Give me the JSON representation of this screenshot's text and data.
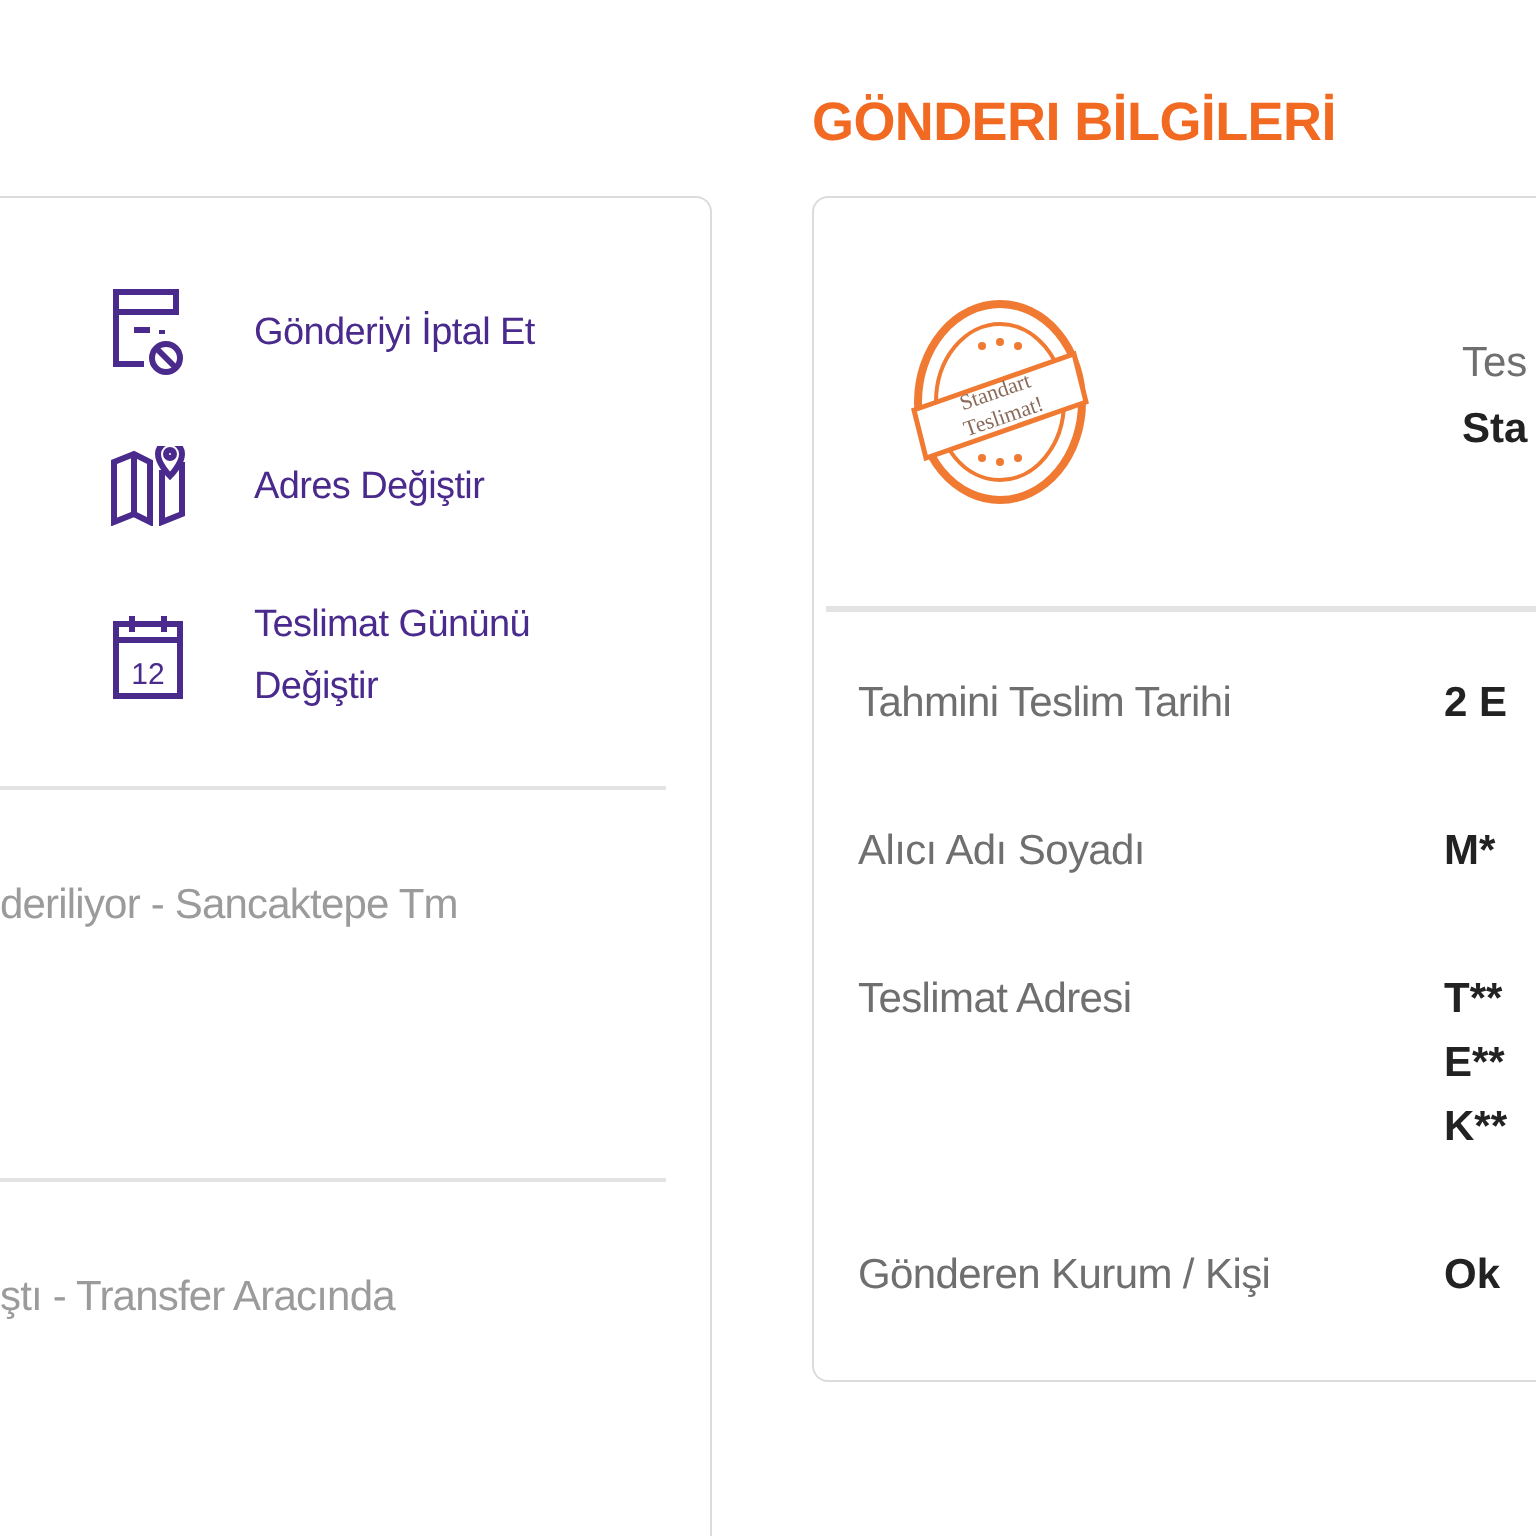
{
  "left_panel": {
    "actions": [
      {
        "kind": "cancel",
        "label": "Gönderiyi İptal Et"
      },
      {
        "kind": "map",
        "label": "Adres Değiştir"
      },
      {
        "kind": "calendar",
        "label": "Teslimat Gününü Değiştir",
        "icon_text": "12"
      }
    ],
    "events": [
      {
        "text": "deriliyor - Sancaktepe Tm"
      },
      {
        "text": "ştı - Transfer Aracında"
      }
    ]
  },
  "shipment_info": {
    "title": "GÖNDERI BİLGİLERİ",
    "stamp": {
      "lines": [
        "Standart",
        "Teslimat!"
      ]
    },
    "delivery_type": {
      "label": "Tes",
      "value": "Sta"
    },
    "rows": [
      {
        "label": "Tahmini Teslim Tarihi",
        "value_lines": [
          "2 E"
        ]
      },
      {
        "label": "Alıcı Adı Soyadı",
        "value_lines": [
          "M*"
        ]
      },
      {
        "label": "Teslimat Adresi",
        "value_lines": [
          "T**",
          "E**",
          "K**"
        ]
      },
      {
        "label": "Gönderen Kurum / Kişi",
        "value_lines": [
          "Ok"
        ]
      }
    ]
  }
}
